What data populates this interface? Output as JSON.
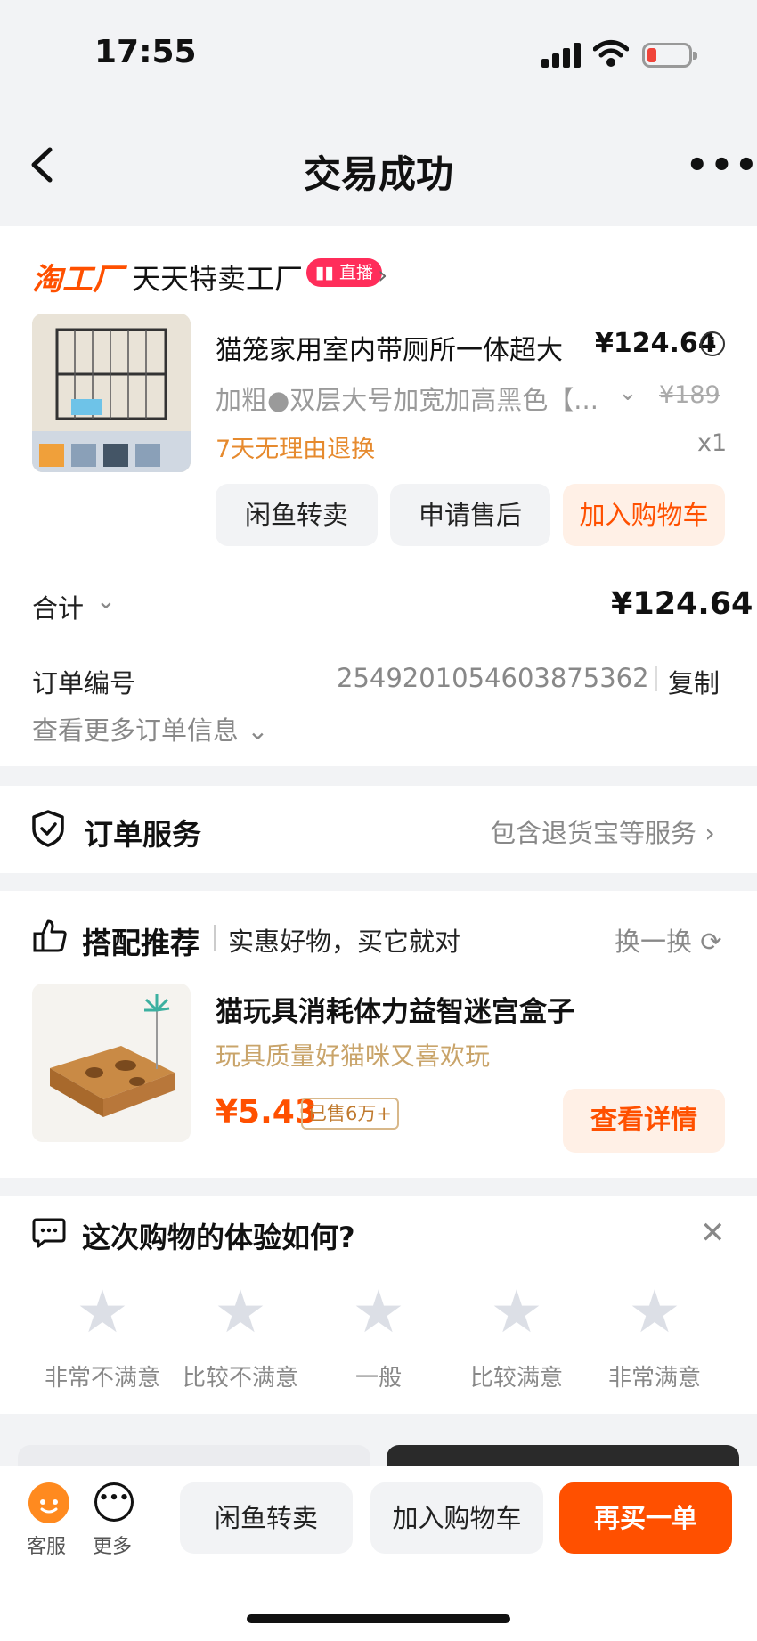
{
  "status_bar": {
    "time": "17:55"
  },
  "nav": {
    "title": "交易成功",
    "back_icon": "chevron-left-icon",
    "more_icon": "more-horizontal-icon"
  },
  "shop": {
    "logo": "淘工厂",
    "name": "天天特卖工厂",
    "live_badge": "直播"
  },
  "product": {
    "title": "猫笼家用室内带厕所一体超大",
    "price": "¥124.64",
    "spec": "加粗●双层大号加宽加高黑色【...",
    "original_price": "¥189",
    "return_policy": "7天无理由退换",
    "quantity": "x1"
  },
  "product_actions": {
    "resell": "闲鱼转卖",
    "after_sale": "申请售后",
    "add_cart": "加入购物车"
  },
  "summary": {
    "total_label": "合计",
    "total_value": "¥124.64",
    "order_no_label": "订单编号",
    "order_no": "2549201054603875362",
    "copy": "复制",
    "more_info": "查看更多订单信息"
  },
  "service": {
    "title": "订单服务",
    "desc": "包含退货宝等服务"
  },
  "recommend": {
    "title": "搭配推荐",
    "subtitle": "实惠好物，买它就对",
    "refresh": "换一换",
    "item_name": "猫玩具消耗体力益智迷宫盒子",
    "item_tag": "玩具质量好猫咪又喜欢玩",
    "item_price": "¥5.43",
    "item_sold": "已售6万+",
    "detail_btn": "查看详情"
  },
  "survey": {
    "title": "这次购物的体验如何?",
    "options": [
      "非常不满意",
      "比较不满意",
      "一般",
      "比较满意",
      "非常满意"
    ]
  },
  "bottom_bar": {
    "customer_service": "客服",
    "more": "更多",
    "resell": "闲鱼转卖",
    "add_cart": "加入购物车",
    "buy_again": "再买一单"
  },
  "colors": {
    "accent": "#ff5000",
    "live": "#ff2d5a",
    "gold": "#c9a46a"
  }
}
